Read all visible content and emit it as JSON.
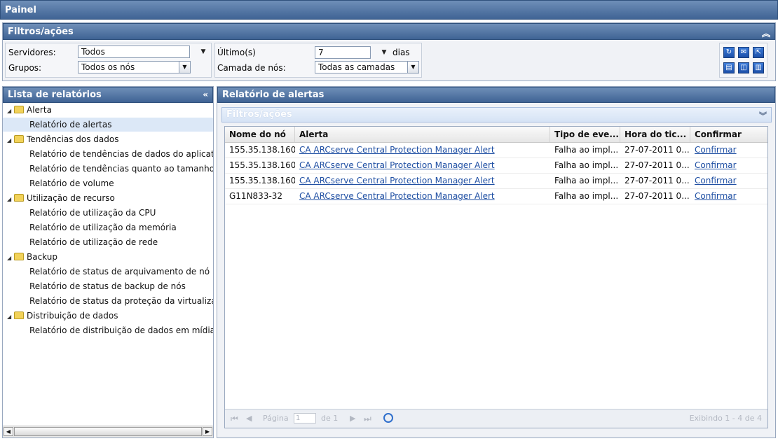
{
  "topbar": {
    "title": "Painel"
  },
  "filters": {
    "title": "Filtros/ações",
    "servers_label": "Servidores:",
    "servers_value": "Todos",
    "groups_label": "Grupos:",
    "groups_value": "Todos os nós",
    "last_label": "Último(s)",
    "last_value": "7",
    "days_label": "dias",
    "tier_label": "Camada de nós:",
    "tier_value": "Todas as camadas"
  },
  "report_list": {
    "title": "Lista de relatórios",
    "groups": [
      {
        "label": "Alerta",
        "items": [
          "Relatório de alertas"
        ]
      },
      {
        "label": "Tendências dos dados",
        "items": [
          "Relatório de tendências de dados do aplicativ",
          "Relatório de tendências quanto ao tamanho d",
          "Relatório de volume"
        ]
      },
      {
        "label": "Utilização de recurso",
        "items": [
          "Relatório de utilização da CPU",
          "Relatório de utilização da memória",
          "Relatório de utilização de rede"
        ]
      },
      {
        "label": "Backup",
        "items": [
          "Relatório de status de arquivamento de nó",
          "Relatório de status de backup de nós",
          "Relatório de status da proteção da virtualizaç"
        ]
      },
      {
        "label": "Distribuição de dados",
        "items": [
          "Relatório de distribuição de dados em mídias"
        ]
      }
    ]
  },
  "alert_report": {
    "title": "Relatório de alertas",
    "filters_title": "Filtros/ações",
    "columns": [
      "Nome do nó",
      "Alerta",
      "Tipo de eve...",
      "Hora do tic...",
      "Confirmar"
    ],
    "rows": [
      [
        "155.35.138.160",
        "CA ARCserve Central Protection Manager Alert",
        "Falha ao impl...",
        "27-07-2011 0...",
        "Confirmar"
      ],
      [
        "155.35.138.160",
        "CA ARCserve Central Protection Manager Alert",
        "Falha ao impl...",
        "27-07-2011 0...",
        "Confirmar"
      ],
      [
        "155.35.138.160",
        "CA ARCserve Central Protection Manager Alert",
        "Falha ao impl...",
        "27-07-2011 0...",
        "Confirmar"
      ],
      [
        "G11N833-32",
        "CA ARCserve Central Protection Manager Alert",
        "Falha ao impl...",
        "27-07-2011 0...",
        "Confirmar"
      ]
    ],
    "pager": {
      "page_label": "Página",
      "page_value": "1",
      "of_label": "de 1",
      "status": "Exibindo 1 - 4 de 4"
    }
  }
}
